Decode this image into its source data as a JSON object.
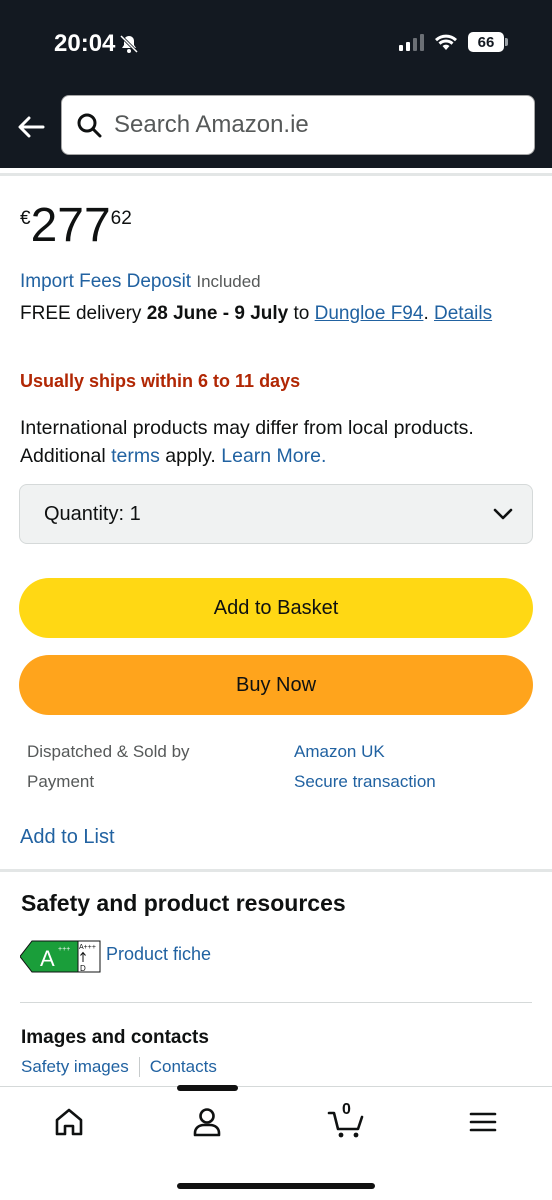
{
  "status_bar": {
    "time": "20:04",
    "battery": "66",
    "icons": [
      "bell-slash-icon",
      "signal-icon",
      "wifi-icon",
      "battery-icon"
    ]
  },
  "header": {
    "search_placeholder": "Search Amazon.ie"
  },
  "price": {
    "currency": "€",
    "whole": "277",
    "fraction": "62"
  },
  "import_fees": {
    "link": "Import Fees Deposit",
    "status": "Included"
  },
  "delivery": {
    "prefix": "FREE delivery",
    "dates": "28 June - 9 July",
    "to": "to",
    "location": "Dungloe F94",
    "details": "Details"
  },
  "availability": "Usually ships within 6 to 11 days",
  "international": {
    "line1": "International products may differ from local products.",
    "additional": "Additional",
    "terms": "terms",
    "apply": "apply.",
    "learn_more": "Learn More."
  },
  "quantity": {
    "label": "Quantity:",
    "value": "1"
  },
  "buttons": {
    "add_to_basket": "Add to Basket",
    "buy_now": "Buy Now"
  },
  "seller_info": [
    {
      "label": "Dispatched & Sold by",
      "value": "Amazon UK"
    },
    {
      "label": "Payment",
      "value": "Secure transaction"
    }
  ],
  "add_to_list": "Add to List",
  "safety": {
    "title": "Safety and product resources",
    "energy_class": "A",
    "energy_scale_top": "A+++",
    "energy_scale_bottom": "D",
    "product_fiche": "Product fiche"
  },
  "images_contacts": {
    "title": "Images and contacts",
    "safety_images": "Safety images",
    "contacts": "Contacts"
  },
  "bottom_nav": {
    "cart_count": "0",
    "items": [
      "home-icon",
      "account-icon",
      "cart-icon",
      "menu-icon"
    ]
  },
  "colors": {
    "header_bg": "#131921",
    "link": "#2162a1",
    "availability": "#b12704",
    "add_to_basket": "#ffd814",
    "buy_now": "#ffa41c",
    "energy_green": "#1a9e3a"
  }
}
